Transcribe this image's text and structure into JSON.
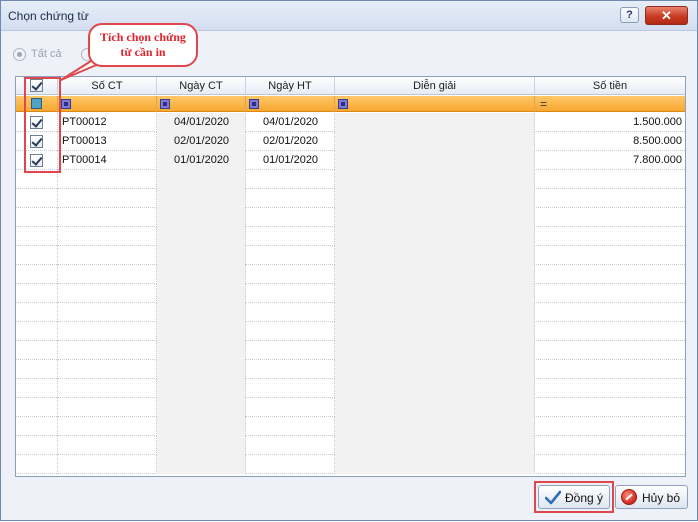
{
  "window": {
    "title": "Chọn chứng từ",
    "help_label": "?",
    "close_label": "✕"
  },
  "radio": {
    "all_label": "Tất cả"
  },
  "annotation": {
    "line1": "Tích chọn chứng",
    "line2": "từ cần in"
  },
  "columns": {
    "so_ct": "Số CT",
    "ngay_ct": "Ngày CT",
    "ngay_ht": "Ngày HT",
    "dien_giai": "Diễn giải",
    "so_tien": "Số tiền"
  },
  "filter": {
    "amount_operator": "="
  },
  "rows": [
    {
      "checked": true,
      "so_ct": "PT00012",
      "ngay_ct": "04/01/2020",
      "ngay_ht": "04/01/2020",
      "dien_giai": "",
      "so_tien": "1.500.000"
    },
    {
      "checked": true,
      "so_ct": "PT00013",
      "ngay_ct": "02/01/2020",
      "ngay_ht": "02/01/2020",
      "dien_giai": "",
      "so_tien": "8.500.000"
    },
    {
      "checked": true,
      "so_ct": "PT00014",
      "ngay_ct": "01/01/2020",
      "ngay_ht": "01/01/2020",
      "dien_giai": "",
      "so_tien": "7.800.000"
    }
  ],
  "buttons": {
    "ok_label": "Đồng ý",
    "cancel_label": "Hủy bỏ"
  },
  "colors": {
    "accent_annotation": "#e0474c",
    "filter_bar": "#f7a830",
    "title_bar": "#d3def0"
  },
  "icons": {
    "ok": "checkmark-icon",
    "cancel": "cancel-circle-icon"
  }
}
